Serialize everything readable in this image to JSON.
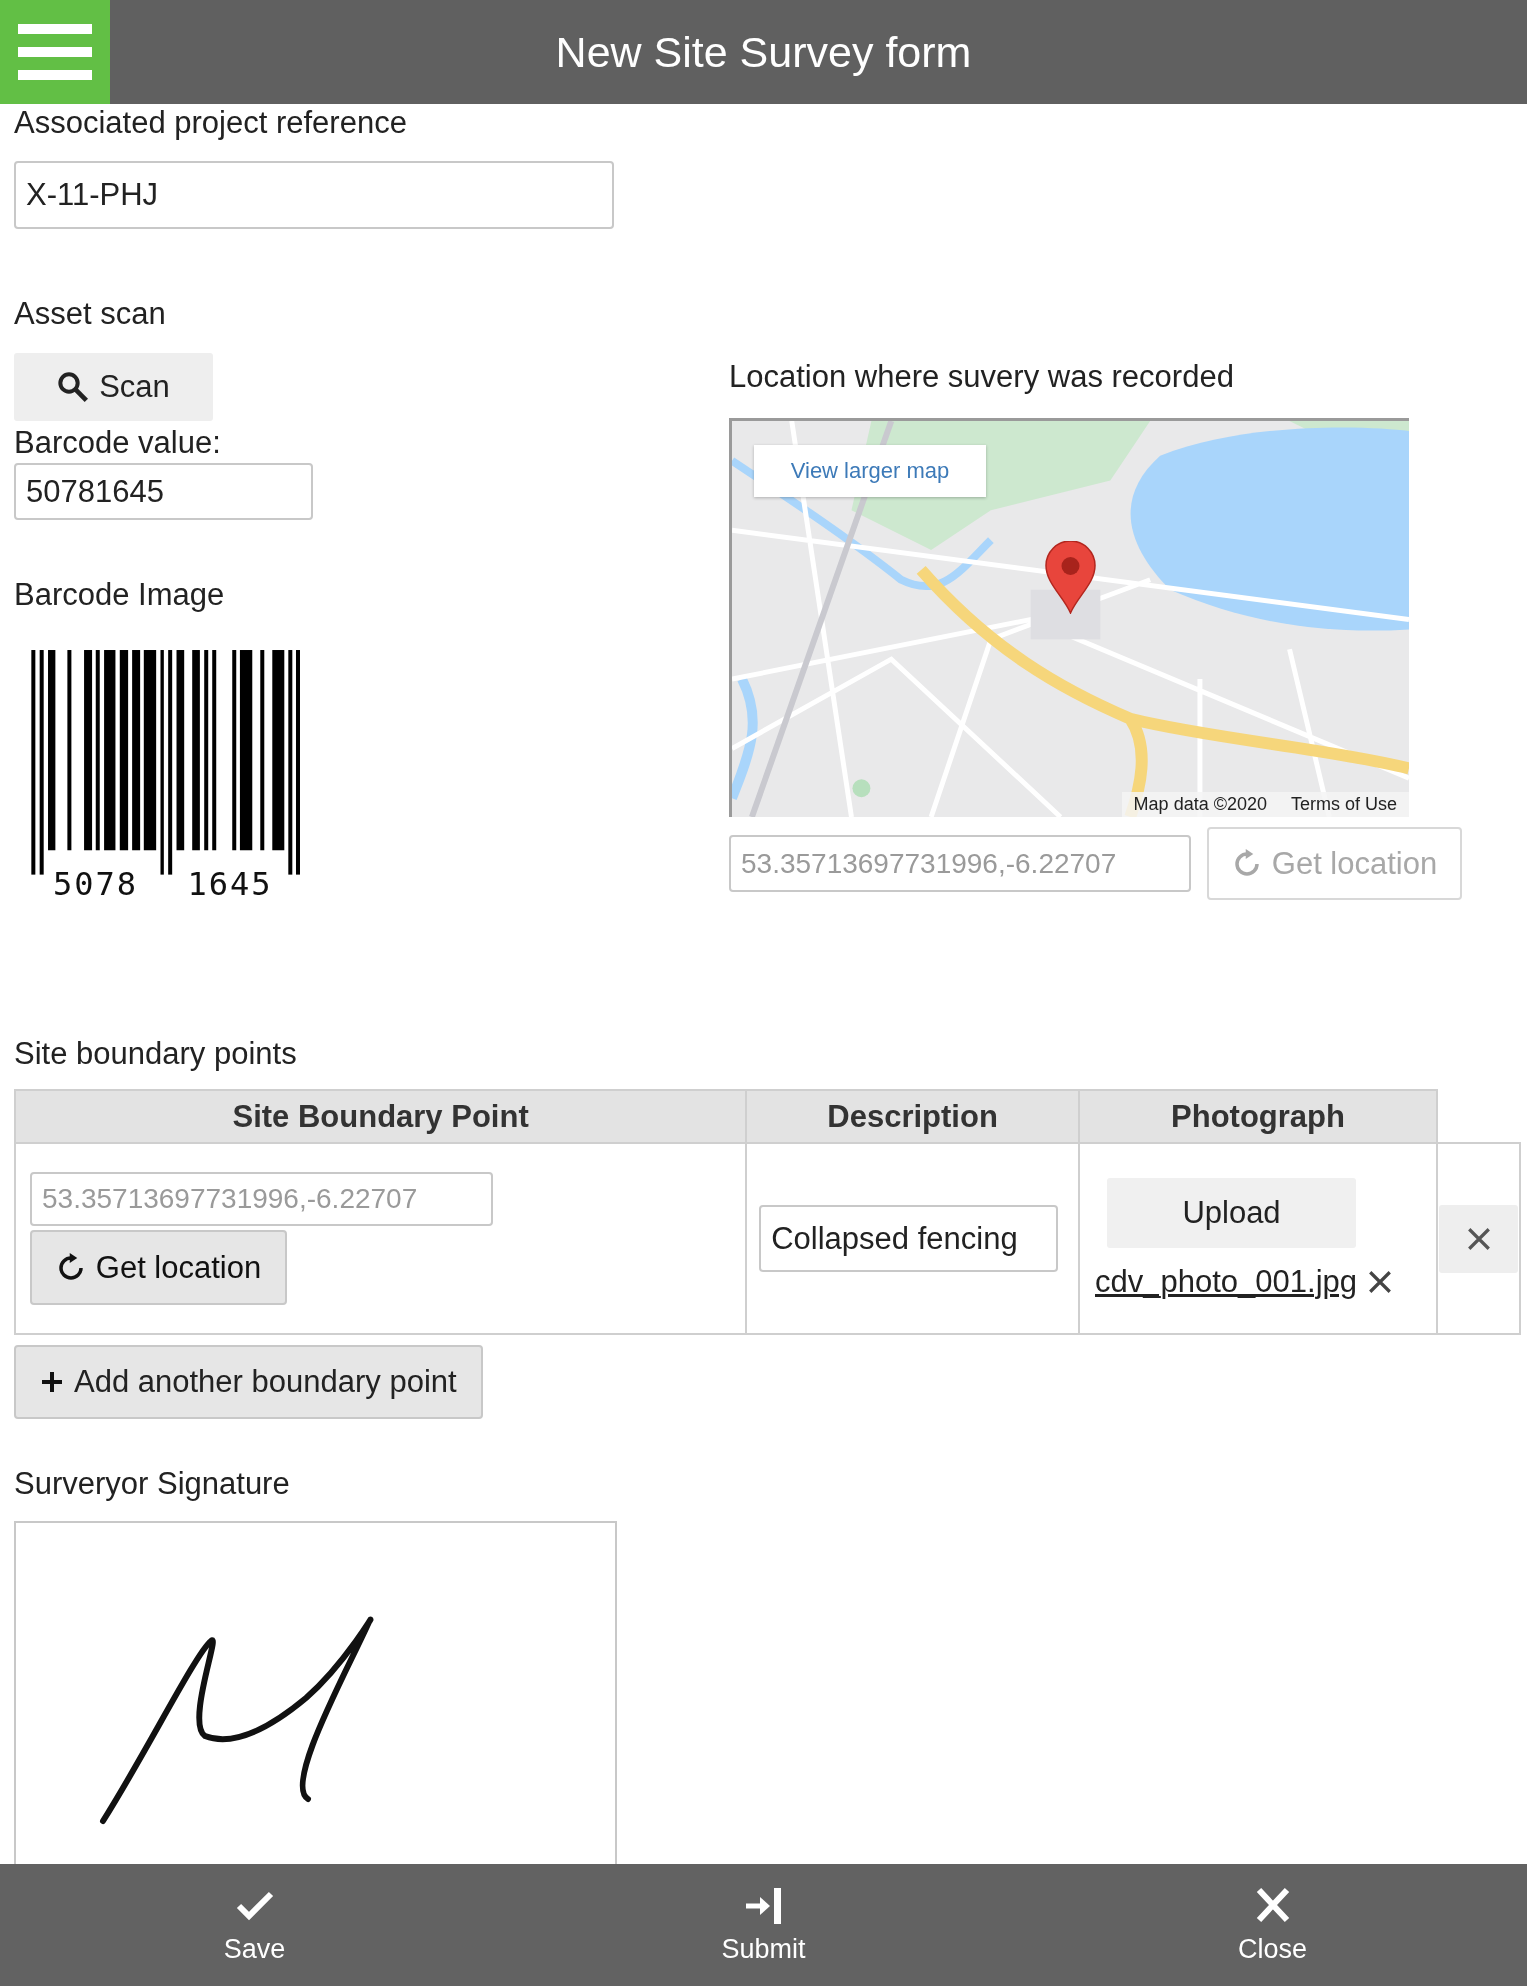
{
  "header": {
    "title": "New Site Survey form"
  },
  "project_reference": {
    "label": "Associated project reference",
    "value": "X-11-PHJ"
  },
  "asset_scan": {
    "label": "Asset scan",
    "scan_button": "Scan",
    "barcode_label": "Barcode value:",
    "barcode_value": "50781645",
    "image_label": "Barcode Image",
    "barcode_digits": [
      "5078",
      "1645"
    ]
  },
  "location": {
    "label": "Location where suvery was recorded",
    "map": {
      "kind": "picture",
      "view_larger": "View larger map",
      "attribution": "Map data ©2020",
      "terms": "Terms of Use"
    },
    "coordinates": {
      "value": "53.35713697731996,-6.22707",
      "disabled": true
    },
    "get_location": {
      "label": "Get location",
      "disabled": true
    }
  },
  "boundary": {
    "label": "Site boundary points",
    "columns": [
      "Site Boundary Point",
      "Description",
      "Photograph"
    ],
    "rows": [
      {
        "coordinates": {
          "value": "53.35713697731996,-6.22707",
          "disabled": true
        },
        "get_location": {
          "label": "Get location",
          "disabled": false
        },
        "description": "Collapsed fencing",
        "upload": "Upload",
        "photo": "cdv_photo_001.jpg"
      }
    ],
    "add_button": "Add another boundary point"
  },
  "signature": {
    "label": "Surveryor Signature"
  },
  "actions": [
    {
      "kind": "save",
      "label": "Save"
    },
    {
      "kind": "submit",
      "label": "Submit"
    },
    {
      "kind": "close",
      "label": "Close"
    }
  ]
}
